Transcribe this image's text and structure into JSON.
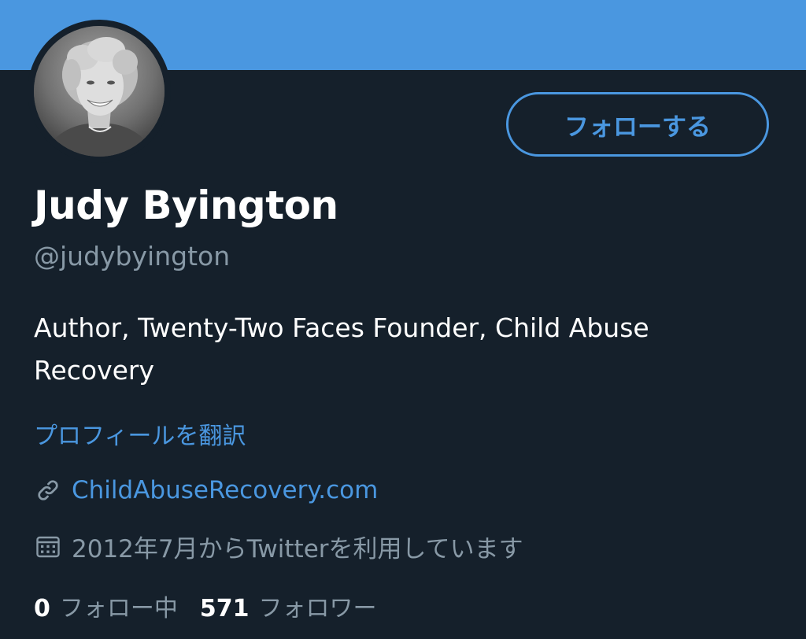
{
  "profile": {
    "name": "Judy Byington",
    "handle": "@judybyington",
    "bio": "Author, Twenty-Two Faces Founder, Child Abuse Recovery",
    "translate_label": "プロフィールを翻訳",
    "website": "ChildAbuseRecovery.com",
    "joined": "2012年7月からTwitterを利用しています",
    "following_count": "0",
    "following_label": "フォロー中",
    "followers_count": "571",
    "followers_label": "フォロワー"
  },
  "actions": {
    "follow_label": "フォローする"
  },
  "icons": {
    "website": "link-icon",
    "joined": "calendar-icon"
  },
  "colors": {
    "background": "#15202b",
    "banner": "#4a97e0",
    "accent": "#4a97e0",
    "text_primary": "#ffffff",
    "text_secondary": "#8899a6"
  }
}
